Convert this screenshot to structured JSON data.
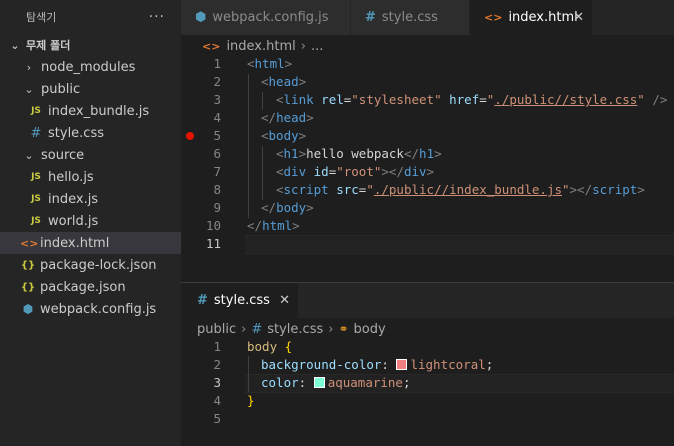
{
  "sidebar": {
    "title": "탐색기",
    "more": "···",
    "root_folder": "무제 폴더",
    "items": [
      {
        "label": "node_modules",
        "icon": "chevron-right-icon"
      },
      {
        "label": "public",
        "icon": "chevron-down-icon"
      },
      {
        "label": "index_bundle.js",
        "icon": "js-file-icon",
        "badge": "JS"
      },
      {
        "label": "style.css",
        "icon": "css-file-icon",
        "badge": "#"
      },
      {
        "label": "source",
        "icon": "chevron-down-icon"
      },
      {
        "label": "hello.js",
        "icon": "js-file-icon",
        "badge": "JS"
      },
      {
        "label": "index.js",
        "icon": "js-file-icon",
        "badge": "JS"
      },
      {
        "label": "world.js",
        "icon": "js-file-icon",
        "badge": "JS"
      },
      {
        "label": "index.html",
        "icon": "html-file-icon",
        "badge": "<>"
      },
      {
        "label": "package-lock.json",
        "icon": "json-file-icon",
        "badge": "{}"
      },
      {
        "label": "package.json",
        "icon": "json-file-icon",
        "badge": "{}"
      },
      {
        "label": "webpack.config.js",
        "icon": "webpack-file-icon",
        "badge": "⬢"
      }
    ]
  },
  "tabs": [
    {
      "label": "webpack.config.js",
      "icon_glyph": "⬢"
    },
    {
      "label": "style.css",
      "icon_glyph": "#"
    },
    {
      "label": "index.html",
      "icon_glyph": "<>",
      "close": "✕"
    }
  ],
  "editor1": {
    "breadcrumb": {
      "file": "index.html",
      "rest": "..."
    },
    "line_numbers": [
      "1",
      "2",
      "3",
      "4",
      "5",
      "6",
      "7",
      "8",
      "9",
      "10",
      "11"
    ],
    "tokens": {
      "html": "html",
      "head": "head",
      "link": "link",
      "rel": "rel",
      "href": "href",
      "stylesheet": "\"stylesheet\"",
      "href_val": "./public//style.css",
      "body": "body",
      "h1": "h1",
      "h1_text": "hello webpack",
      "div": "div",
      "id": "id",
      "root": "\"root\"",
      "script": "script",
      "src": "src",
      "src_val": "./public//index_bundle.js"
    }
  },
  "editor2": {
    "tab": {
      "label": "style.css",
      "icon_glyph": "#",
      "close": "✕"
    },
    "breadcrumb": {
      "folder": "public",
      "file": "style.css",
      "symbol": "body"
    },
    "line_numbers": [
      "1",
      "2",
      "3",
      "4",
      "5"
    ],
    "tokens": {
      "selector": "body",
      "open_brace": "{",
      "close_brace": "}",
      "prop1": "background-color",
      "val1": "lightcoral",
      "prop2": "color",
      "val2": "aquamarine"
    },
    "colors": {
      "lightcoral": "#f08080",
      "aquamarine": "#7fffd4"
    }
  }
}
